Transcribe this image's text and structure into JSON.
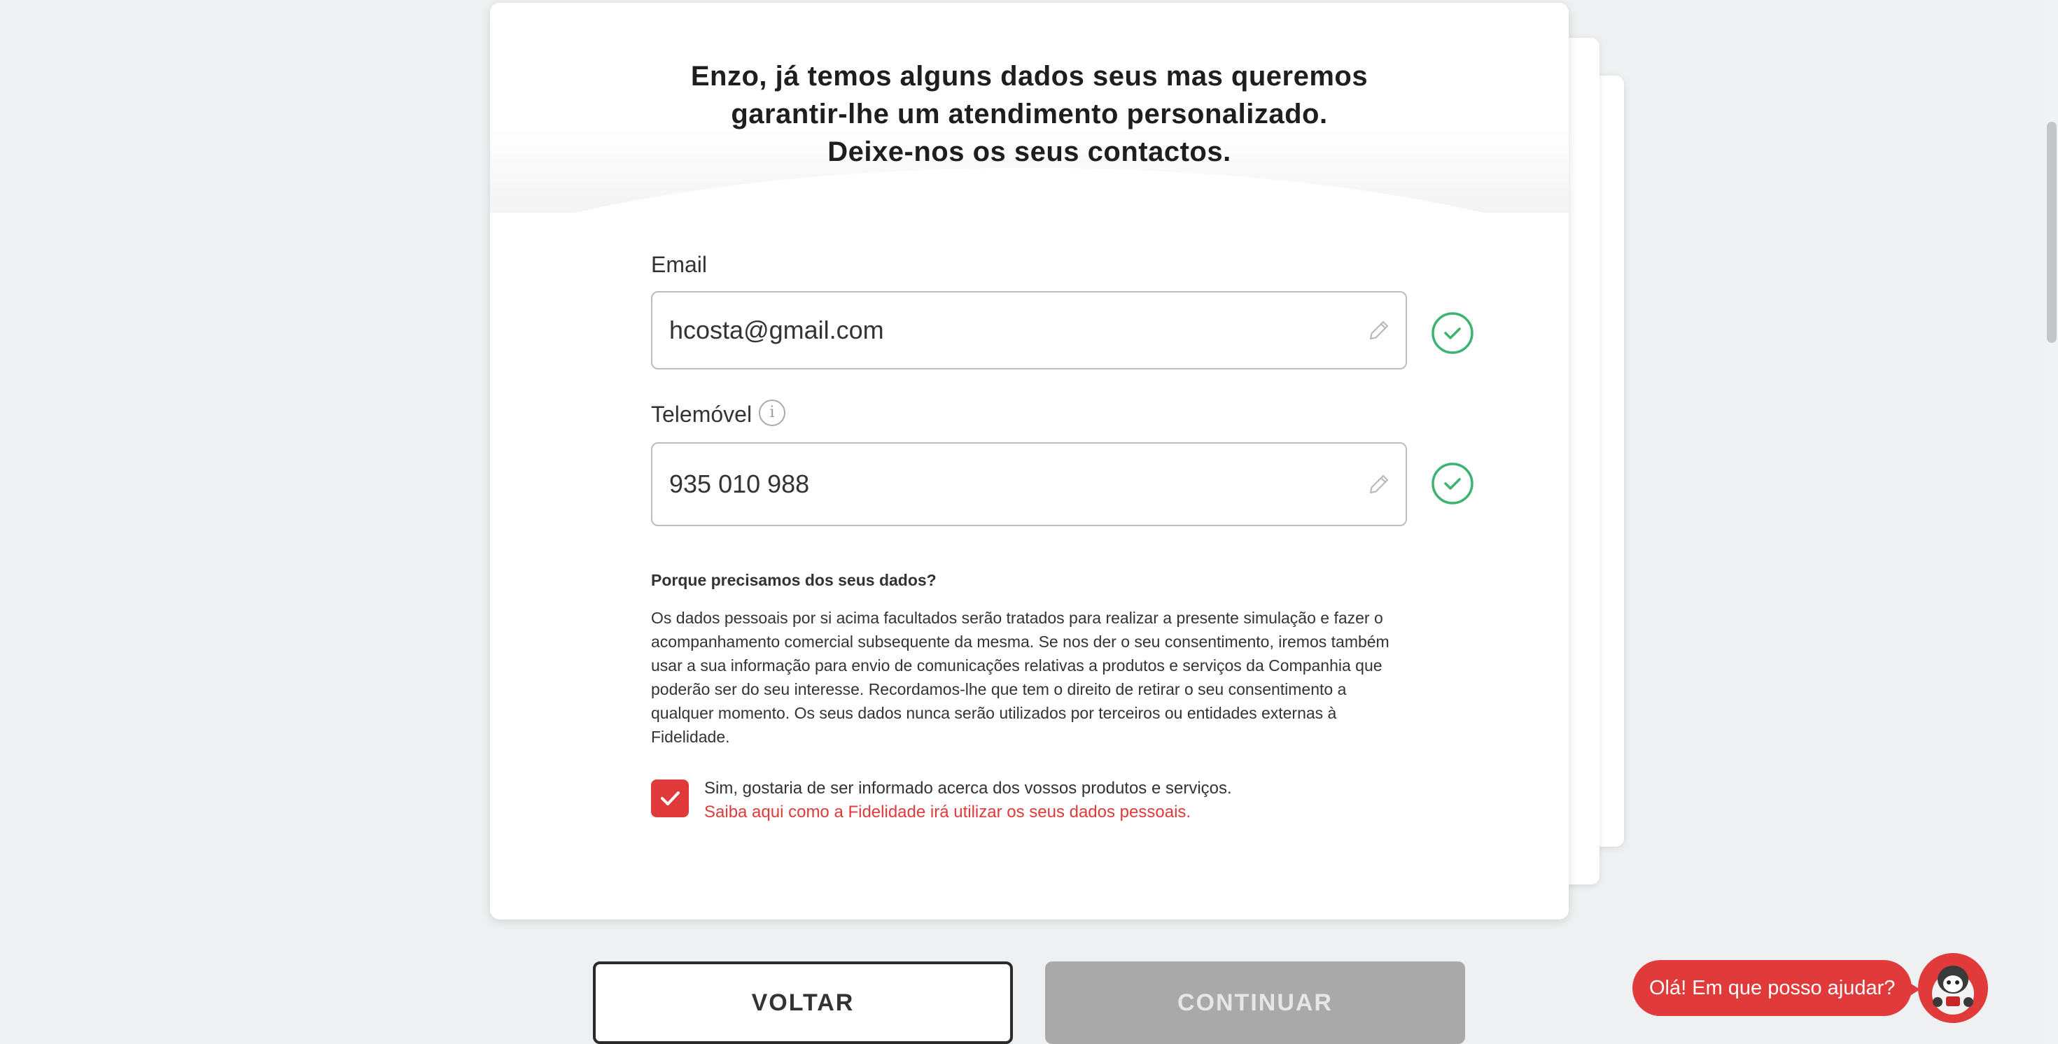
{
  "form": {
    "title_line1": "Enzo, já temos alguns dados seus mas queremos",
    "title_line2": "garantir-lhe um atendimento personalizado.",
    "title_line3": "Deixe-nos os seus contactos.",
    "email": {
      "label": "Email",
      "value": "hcosta@gmail.com"
    },
    "phone": {
      "label": "Telemóvel",
      "value": "935 010 988"
    },
    "why_title": "Porque precisamos dos seus dados?",
    "why_text": "Os dados pessoais por si acima facultados serão tratados para realizar a presente simulação e fazer o acompanhamento comercial subsequente da mesma. Se nos der o seu consentimento, iremos também usar a sua informação para envio de comunicações relativas a produtos e serviços da Companhia que poderão ser do seu interesse. Recordamos-lhe que tem o direito de retirar o seu consentimento a qualquer momento. Os seus dados nunca serão utilizados por terceiros ou entidades externas à Fidelidade.",
    "consent_text": "Sim, gostaria de ser informado acerca dos vossos produtos e serviços.",
    "consent_link": "Saiba aqui como a Fidelidade irá utilizar os seus dados pessoais.",
    "consent_checked": true
  },
  "buttons": {
    "back": "VOLTAR",
    "continue": "CONTINUAR"
  },
  "chat": {
    "greeting": "Olá! Em que posso ajudar?"
  },
  "colors": {
    "accent": "#e03a3a",
    "success": "#3cb371",
    "disabled": "#a9a9a9"
  },
  "icons": [
    "pencil-icon",
    "check-circle-icon",
    "info-icon",
    "checkmark-icon",
    "chatbot-avatar-icon"
  ]
}
